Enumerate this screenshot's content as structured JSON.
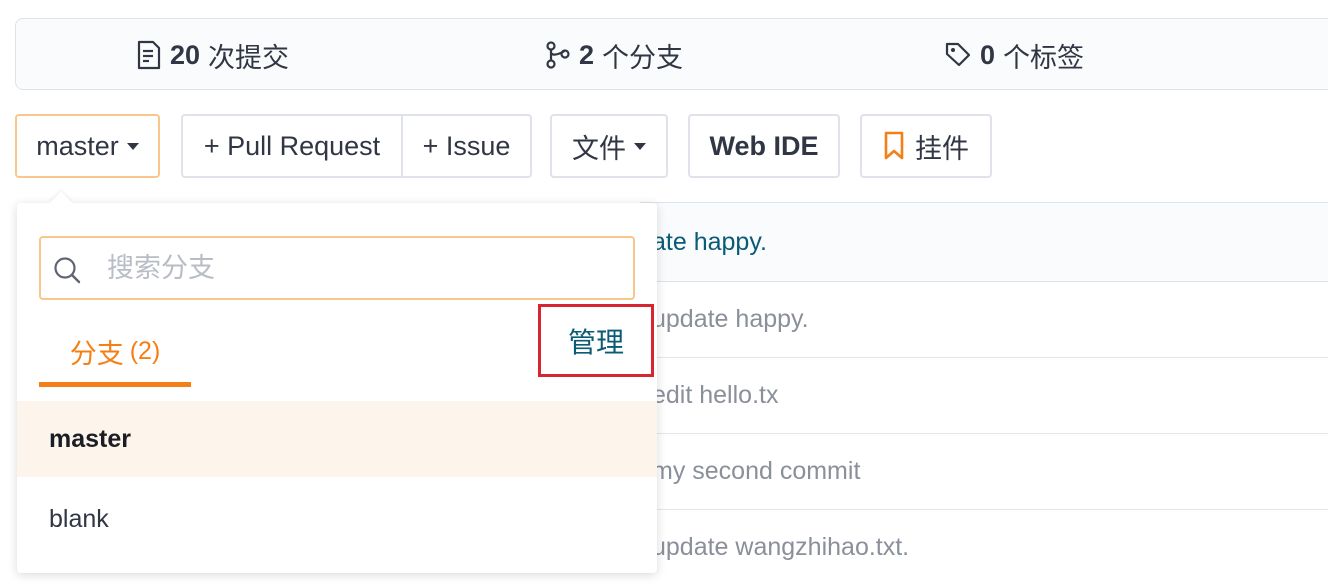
{
  "stats": {
    "commits": {
      "count": "20",
      "label": "次提交",
      "icon": "commit-icon"
    },
    "branches": {
      "count": "2",
      "label": "个分支",
      "icon": "branch-icon"
    },
    "tags": {
      "count": "0",
      "label": "个标签",
      "icon": "tag-icon"
    }
  },
  "toolbar": {
    "branch_select": "master",
    "pull_request": "+ Pull Request",
    "issue": "+ Issue",
    "files": "文件",
    "web_ide": "Web IDE",
    "plugins": "挂件"
  },
  "dropdown": {
    "search_placeholder": "搜索分支",
    "tab_label": "分支",
    "tab_count": "(2)",
    "manage_label": "管理",
    "branches": [
      {
        "name": "master",
        "active": true
      },
      {
        "name": "blank",
        "active": false
      }
    ]
  },
  "commits": {
    "header_message": "ate happy.",
    "rows": [
      "update happy.",
      "edit hello.tx",
      "my second commit",
      "update wangzhihao.txt."
    ]
  },
  "colors": {
    "accent": "#f57f17",
    "link": "#0a5b76",
    "highlight_border": "#d9252f"
  }
}
